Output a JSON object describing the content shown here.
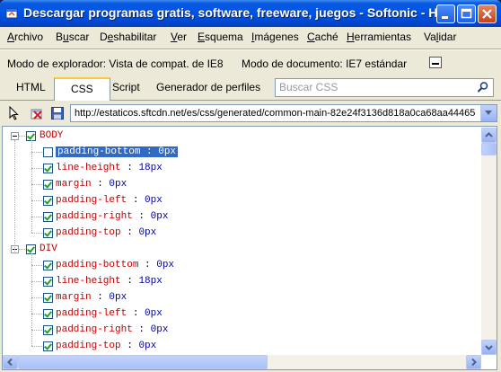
{
  "window": {
    "title": "Descargar programas gratis, software, freeware, juegos - Softonic - He..."
  },
  "menu": [
    {
      "pre": "",
      "u": "A",
      "post": "rchivo"
    },
    {
      "pre": "B",
      "u": "u",
      "post": "scar"
    },
    {
      "pre": "D",
      "u": "e",
      "post": "shabilitar"
    },
    {
      "pre": "",
      "u": "V",
      "post": "er"
    },
    {
      "pre": "",
      "u": "E",
      "post": "squema"
    },
    {
      "pre": "",
      "u": "I",
      "post": "mágenes"
    },
    {
      "pre": "",
      "u": "C",
      "post": "aché"
    },
    {
      "pre": "",
      "u": "H",
      "post": "erramientas"
    },
    {
      "pre": "Va",
      "u": "l",
      "post": "idar"
    }
  ],
  "modebar": {
    "browser_mode": "Modo de explorador: Vista de compat. de IE8",
    "document_mode": "Modo de documento: IE7 estándar"
  },
  "tabs": {
    "html": "HTML",
    "css": "CSS",
    "script": "Script",
    "profiler": "Generador de perfiles"
  },
  "search": {
    "placeholder": "Buscar CSS"
  },
  "url": "http://estaticos.sftcdn.net/es/css/generated/common-main-82e24f3136d818a0ca68aa44465",
  "rules": [
    {
      "selector": "BODY",
      "checked": true,
      "properties": [
        {
          "name": "padding-bottom",
          "value": "0px",
          "checked": false,
          "selected": true
        },
        {
          "name": "line-height",
          "value": "18px",
          "checked": true,
          "selected": false
        },
        {
          "name": "margin",
          "value": "0px",
          "checked": true,
          "selected": false
        },
        {
          "name": "padding-left",
          "value": "0px",
          "checked": true,
          "selected": false
        },
        {
          "name": "padding-right",
          "value": "0px",
          "checked": true,
          "selected": false
        },
        {
          "name": "padding-top",
          "value": "0px",
          "checked": true,
          "selected": false
        }
      ]
    },
    {
      "selector": "DIV",
      "checked": true,
      "properties": [
        {
          "name": "padding-bottom",
          "value": "0px",
          "checked": true,
          "selected": false
        },
        {
          "name": "line-height",
          "value": "18px",
          "checked": true,
          "selected": false
        },
        {
          "name": "margin",
          "value": "0px",
          "checked": true,
          "selected": false
        },
        {
          "name": "padding-left",
          "value": "0px",
          "checked": true,
          "selected": false
        },
        {
          "name": "padding-right",
          "value": "0px",
          "checked": true,
          "selected": false
        },
        {
          "name": "padding-top",
          "value": "0px",
          "checked": true,
          "selected": false
        }
      ]
    }
  ],
  "colors": {
    "titlebar": "#0055e5",
    "selection": "#316ac5",
    "property": "#c00000",
    "value": "#00009c"
  }
}
